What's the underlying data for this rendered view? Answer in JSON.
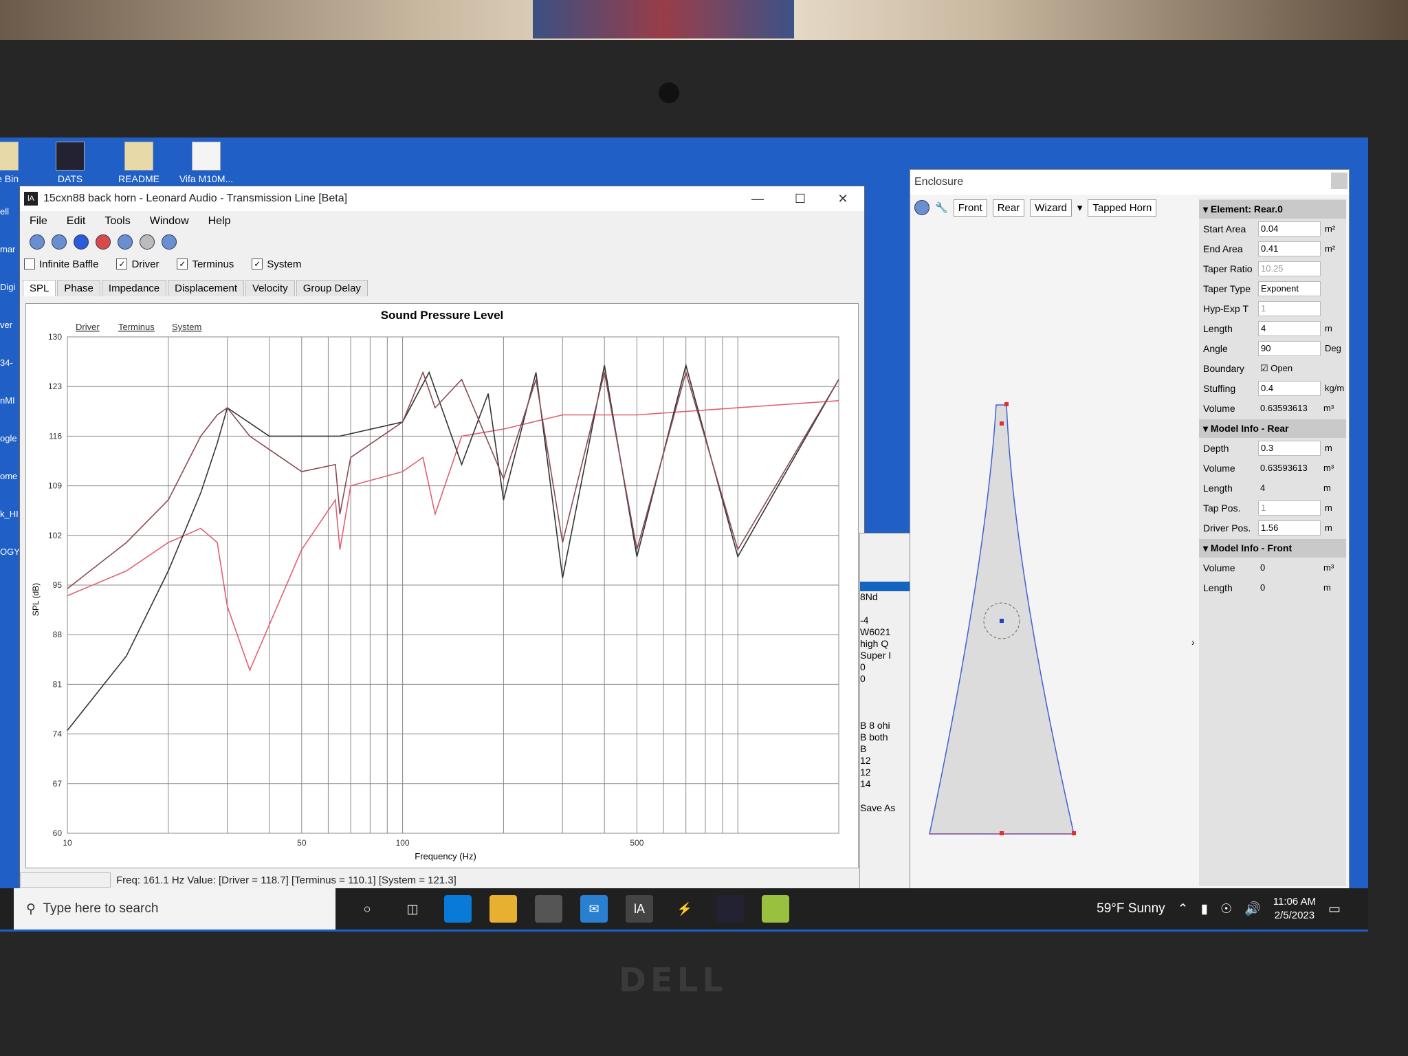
{
  "desktop_icons": [
    {
      "label": "cle Bin"
    },
    {
      "label": "DATS"
    },
    {
      "label": "README"
    },
    {
      "label": "Vifa M10M..."
    }
  ],
  "left_strip_labels": [
    "ell",
    "mar",
    "Digi",
    "ver",
    "34-",
    "nMI",
    "ogle",
    "ome",
    "k_HI",
    "OGY"
  ],
  "app": {
    "title": "15cxn88 back horn - Leonard Audio - Transmission Line [Beta]",
    "menu": [
      "File",
      "Edit",
      "Tools",
      "Window",
      "Help"
    ],
    "checkboxes": [
      {
        "label": "Infinite Baffle",
        "checked": false
      },
      {
        "label": "Driver",
        "checked": true
      },
      {
        "label": "Terminus",
        "checked": true
      },
      {
        "label": "System",
        "checked": true
      }
    ],
    "tabs": [
      "SPL",
      "Phase",
      "Impedance",
      "Displacement",
      "Velocity",
      "Group Delay"
    ],
    "active_tab": "SPL",
    "status_text": "Freq: 161.1 Hz   Value: [Driver = 118.7]  [Terminus = 110.1]  [System = 121.3]"
  },
  "chart_data": {
    "type": "line",
    "title": "Sound Pressure Level",
    "xlabel": "Frequency (Hz)",
    "ylabel": "SPL (dB)",
    "xscale": "log",
    "xlim": [
      10,
      2000
    ],
    "ylim": [
      60,
      130
    ],
    "x_tick_labels": [
      "10",
      "50",
      "100",
      "500"
    ],
    "y_tick_labels": [
      "130",
      "123",
      "116",
      "109",
      "102",
      "95",
      "88",
      "81",
      "74",
      "67",
      "60"
    ],
    "legend": [
      "Driver",
      "Terminus",
      "System"
    ],
    "grid": true,
    "series": [
      {
        "name": "Driver",
        "color": "#e06070",
        "x": [
          10,
          15,
          20,
          25,
          28,
          30,
          35,
          50,
          63,
          65,
          70,
          100,
          115,
          125,
          150,
          200,
          300,
          500,
          1000,
          2000
        ],
        "y": [
          93.5,
          97,
          101,
          103,
          101,
          92,
          83,
          100,
          107,
          100,
          109,
          111,
          113,
          105,
          116,
          117,
          119,
          119,
          120,
          121
        ]
      },
      {
        "name": "Terminus",
        "color": "#333333",
        "x": [
          10,
          15,
          20,
          25,
          28,
          30,
          40,
          50,
          65,
          100,
          120,
          150,
          180,
          200,
          250,
          300,
          400,
          500,
          700,
          1000,
          2000
        ],
        "y": [
          74.5,
          85,
          97,
          108,
          115,
          120,
          116,
          116,
          116,
          118,
          125,
          112,
          122,
          107,
          125,
          96,
          126,
          99,
          126,
          99,
          124
        ]
      },
      {
        "name": "System",
        "color": "#8a4a50",
        "x": [
          10,
          15,
          20,
          25,
          28,
          30,
          35,
          50,
          63,
          65,
          70,
          100,
          115,
          125,
          150,
          200,
          250,
          300,
          400,
          500,
          700,
          1000,
          2000
        ],
        "y": [
          94.5,
          101,
          107,
          116,
          119,
          120,
          116,
          111,
          112,
          105,
          113,
          118,
          125,
          120,
          124,
          110,
          124,
          101,
          125,
          100,
          125,
          100,
          124
        ]
      }
    ]
  },
  "enclosure": {
    "title": "Enclosure",
    "buttons": [
      "Front",
      "Rear",
      "Wizard",
      "Tapped Horn"
    ],
    "element_header": "Element: Rear.0",
    "properties": [
      {
        "label": "Start Area",
        "value": "0.04",
        "unit": "m²"
      },
      {
        "label": "End Area",
        "value": "0.41",
        "unit": "m²"
      },
      {
        "label": "Taper Ratio",
        "value": "10.25",
        "unit": ""
      },
      {
        "label": "Taper Type",
        "value": "Exponent",
        "unit": ""
      },
      {
        "label": "Hyp-Exp T",
        "value": "1",
        "unit": ""
      },
      {
        "label": "Length",
        "value": "4",
        "unit": "m"
      },
      {
        "label": "Angle",
        "value": "90",
        "unit": "Deg"
      },
      {
        "label": "Boundary",
        "value": "Open",
        "unit": ""
      },
      {
        "label": "Stuffing",
        "value": "0.4",
        "unit": "kg/m"
      },
      {
        "label": "Volume",
        "value": "0.63593613",
        "unit": "m³"
      }
    ],
    "rear_header": "Model Info - Rear",
    "rear": [
      {
        "label": "Depth",
        "value": "0.3",
        "unit": "m"
      },
      {
        "label": "Volume",
        "value": "0.63593613",
        "unit": "m³"
      },
      {
        "label": "Length",
        "value": "4",
        "unit": "m"
      },
      {
        "label": "Tap Pos.",
        "value": "1",
        "unit": "m"
      },
      {
        "label": "Driver Pos.",
        "value": "1.56",
        "unit": "m"
      }
    ],
    "front_header": "Model Info - Front",
    "front": [
      {
        "label": "Volume",
        "value": "0",
        "unit": "m³"
      },
      {
        "label": "Length",
        "value": "0",
        "unit": "m"
      }
    ]
  },
  "mid_window_lines": [
    "8Nd",
    "",
    "-4",
    "W6021",
    "high Q",
    "Super I",
    "0",
    "0",
    "",
    "",
    "",
    "B 8 ohi",
    "B both",
    "B",
    "12",
    "12",
    "14"
  ],
  "mid_window_button": "Save As",
  "taskbar": {
    "search_placeholder": "Type here to search",
    "weather": "59°F  Sunny",
    "time": "11:06 AM",
    "date": "2/5/2023"
  },
  "brand": "DELL"
}
